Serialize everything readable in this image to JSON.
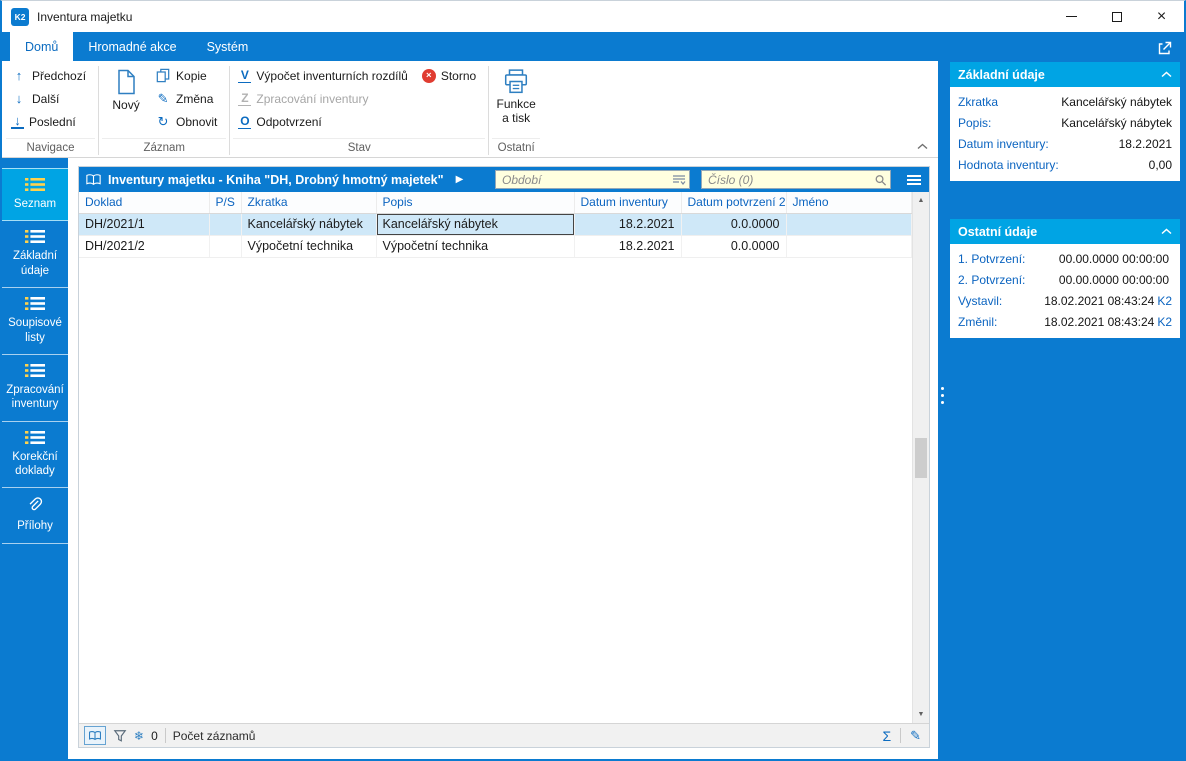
{
  "window": {
    "title": "Inventura majetku"
  },
  "tabs": [
    {
      "label": "Domů"
    },
    {
      "label": "Hromadné akce"
    },
    {
      "label": "Systém"
    }
  ],
  "ribbon": {
    "nav": {
      "prev": "Předchozí",
      "next": "Další",
      "last": "Poslední",
      "group": "Navigace"
    },
    "record": {
      "new": "Nový",
      "copy": "Kopie",
      "change": "Změna",
      "refresh": "Obnovit",
      "group": "Záznam"
    },
    "state": {
      "calc": "Výpočet inventurních rozdílů",
      "cancel": "Storno",
      "process": "Zpracování inventury",
      "unconfirm": "Odpotvrzení",
      "group": "Stav"
    },
    "other": {
      "print": "Funkce a tisk",
      "group": "Ostatní"
    }
  },
  "icons": {
    "prev": "↑",
    "next": "↓",
    "last": "↓",
    "refresh": "↻",
    "edit": "✎",
    "calc_letter": "V",
    "process_letter": "Z",
    "unconfirm_letter": "O",
    "cancel_x": "×",
    "play": "▶",
    "sigma": "Σ",
    "snowflake": "❄",
    "close": "×",
    "scroll_up": "▲",
    "scroll_down": "▼"
  },
  "sidebar": {
    "items": [
      {
        "label": "Seznam"
      },
      {
        "label": "Základní údaje"
      },
      {
        "label": "Soupisové listy"
      },
      {
        "label": "Zpracování inventury"
      },
      {
        "label": "Korekční doklady"
      },
      {
        "label": "Přílohy"
      }
    ]
  },
  "grid": {
    "title": "Inventury majetku - Kniha \"DH, Drobný hmotný majetek\"",
    "period_placeholder": "Období",
    "number_placeholder": "Číslo (0)",
    "columns": [
      "Doklad",
      "P/S",
      "Zkratka",
      "Popis",
      "Datum inventury",
      "Datum potvrzení 2",
      "Jméno"
    ],
    "rows": [
      [
        "DH/2021/1",
        "",
        "Kancelářský nábytek",
        "Kancelářský nábytek",
        "18.2.2021",
        "0.0.0000",
        ""
      ],
      [
        "DH/2021/2",
        "",
        "Výpočetní technika",
        "Výpočetní technika",
        "18.2.2021",
        "0.0.0000",
        ""
      ]
    ],
    "status": {
      "flag_count": "0",
      "count_label": "Počet záznamů"
    }
  },
  "panel": {
    "basic": {
      "title": "Základní údaje",
      "fields": [
        {
          "label": "Zkratka",
          "value": "Kancelářský nábytek"
        },
        {
          "label": "Popis:",
          "value": "Kancelářský nábytek"
        },
        {
          "label": "Datum inventury:",
          "value": "18.2.2021"
        },
        {
          "label": "Hodnota inventury:",
          "value": "0,00"
        }
      ]
    },
    "other": {
      "title": "Ostatní údaje",
      "fields": [
        {
          "label": "1. Potvrzení:",
          "value": "00.00.0000 00:00:00",
          "suffix": ""
        },
        {
          "label": "2. Potvrzení:",
          "value": "00.00.0000 00:00:00",
          "suffix": ""
        },
        {
          "label": "Vystavil:",
          "value": "18.02.2021 08:43:24",
          "suffix": "K2"
        },
        {
          "label": "Změnil:",
          "value": "18.02.2021 08:43:24",
          "suffix": "K2"
        }
      ]
    }
  }
}
